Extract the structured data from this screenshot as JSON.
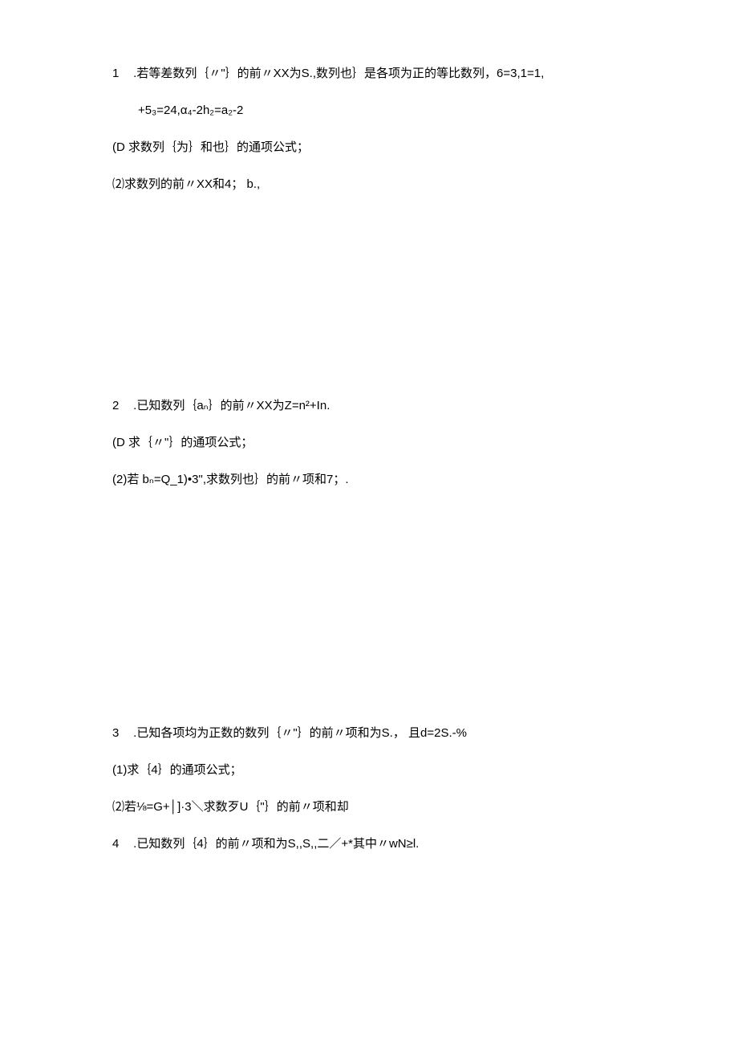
{
  "q1": {
    "number": "1",
    "line1": " .若等差数列｛〃\"｝的前〃XX为S.,数列也｝是各项为正的等比数列，6=3,1=1,",
    "line2_indent": "+5₃=24,α₄-2h₂=a₂-2",
    "part1": "(D 求数列｛为｝和也｝的通项公式；",
    "part2": "⑵求数列的前〃XX和4； b.,"
  },
  "q2": {
    "number": "2",
    "line1": "  .已知数列｛aₙ｝的前〃XX为Z=n²+In.",
    "part1": "(D 求｛〃\"｝的通项公式；",
    "part2": "(2)若 bₙ=Q_1)•3\",求数列也｝的前〃项和7；."
  },
  "q3": {
    "number": "3",
    "line1": "  .已知各项均为正数的数列｛〃\"｝的前〃项和为S.， 且d=2S.-%",
    "part1": "(1)求｛4｝的通项公式；",
    "part2": "⑵若⅛=G+│]·3＼求数歹U｛\"｝的前〃项和却"
  },
  "q4": {
    "number": "4",
    "line1": "  .已知数列｛4｝的前〃项和为S,,S,,二／+*其中〃wN≥l."
  }
}
